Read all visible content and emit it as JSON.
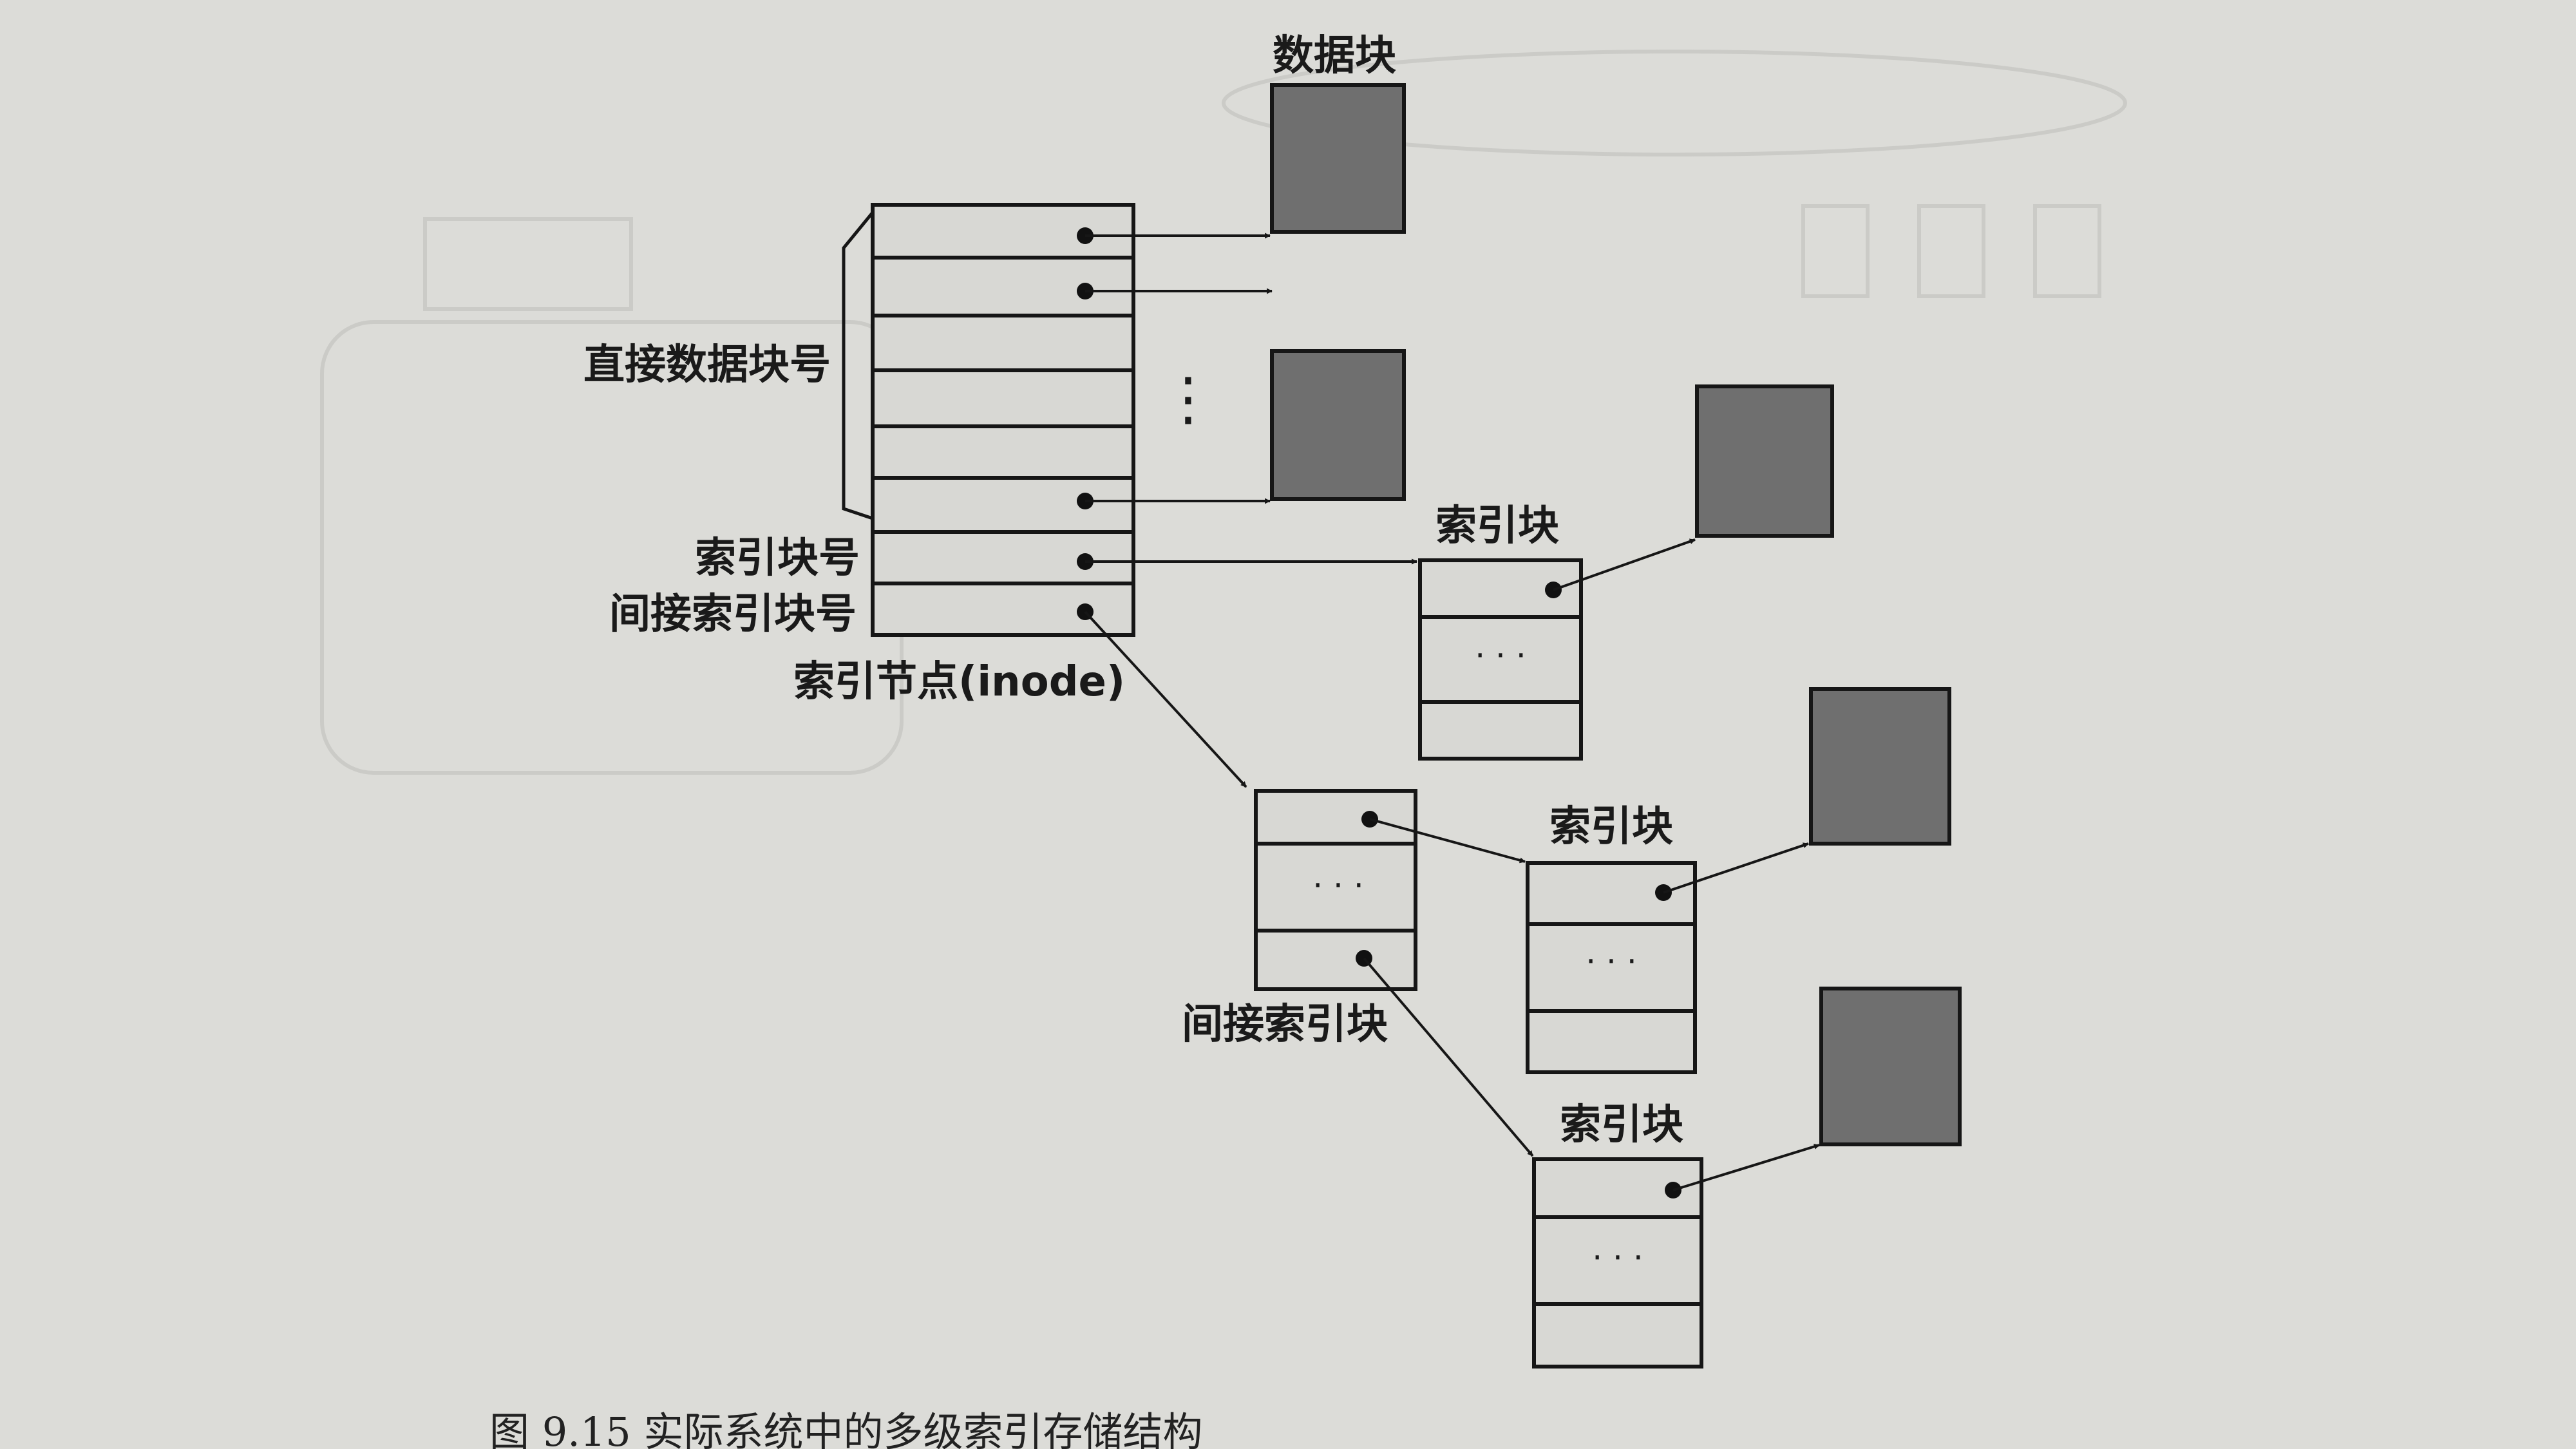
{
  "diagram": {
    "labels": {
      "data_block": "数据块",
      "direct_block_numbers": "直接数据块号",
      "index_block_number": "索引块号",
      "indirect_index_block_number": "间接索引块号",
      "inode": "索引节点(inode)",
      "index_block_1": "索引块",
      "index_block_2": "索引块",
      "index_block_3": "索引块",
      "indirect_index_block": "间接索引块",
      "vdots": "⋮",
      "ellipsis": "· · ·"
    },
    "caption": "图 9.15   实际系统中的多级索引存储结构",
    "colors": {
      "block_fill": "#6f6f6f",
      "line": "#161616",
      "paper": "#dcdcd8"
    }
  }
}
